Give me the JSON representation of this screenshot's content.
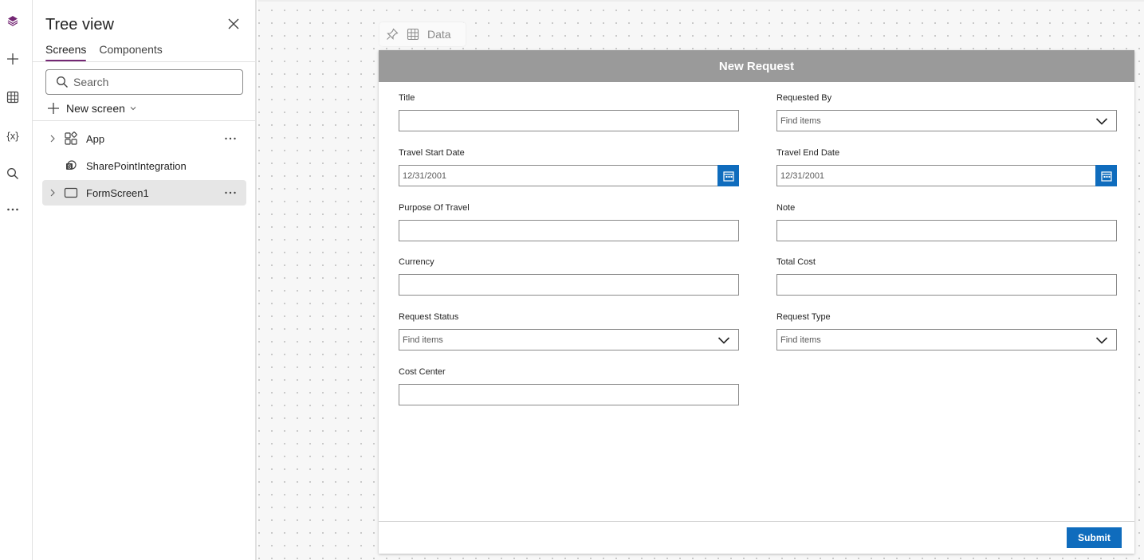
{
  "tree_panel": {
    "title": "Tree view",
    "tabs": [
      {
        "label": "Screens",
        "active": true
      },
      {
        "label": "Components",
        "active": false
      }
    ],
    "search_placeholder": "Search",
    "new_screen_label": "New screen",
    "items": [
      {
        "label": "App",
        "icon": "app-icon",
        "expandable": true
      },
      {
        "label": "SharePointIntegration",
        "icon": "sharepoint-icon",
        "expandable": false
      },
      {
        "label": "FormScreen1",
        "icon": "screen-icon",
        "expandable": true,
        "selected": true
      }
    ]
  },
  "rail_icons": [
    "layers-icon",
    "plus-icon",
    "table-icon",
    "variable-icon",
    "search-icon",
    "more-icon"
  ],
  "mini_toolbar": {
    "data_label": "Data"
  },
  "form": {
    "header_title": "New Request",
    "left_fields": [
      {
        "label": "Title",
        "type": "text",
        "value": ""
      },
      {
        "label": "Travel Start Date",
        "type": "date",
        "value": "12/31/2001"
      },
      {
        "label": "Purpose Of Travel",
        "type": "text",
        "value": ""
      },
      {
        "label": "Currency",
        "type": "text",
        "value": ""
      },
      {
        "label": "Request Status",
        "type": "combo",
        "value": "Find items"
      },
      {
        "label": "Cost Center",
        "type": "text",
        "value": ""
      }
    ],
    "right_fields": [
      {
        "label": "Requested By",
        "type": "combo",
        "value": "Find items"
      },
      {
        "label": "Travel End Date",
        "type": "date",
        "value": "12/31/2001"
      },
      {
        "label": "Note",
        "type": "text",
        "value": ""
      },
      {
        "label": "Total Cost",
        "type": "text",
        "value": ""
      },
      {
        "label": "Request Type",
        "type": "combo",
        "value": "Find items"
      }
    ],
    "submit_label": "Submit"
  },
  "colors": {
    "accent": "#742774",
    "primary": "#0f6cbd",
    "header_bg": "#9a9a9a"
  }
}
